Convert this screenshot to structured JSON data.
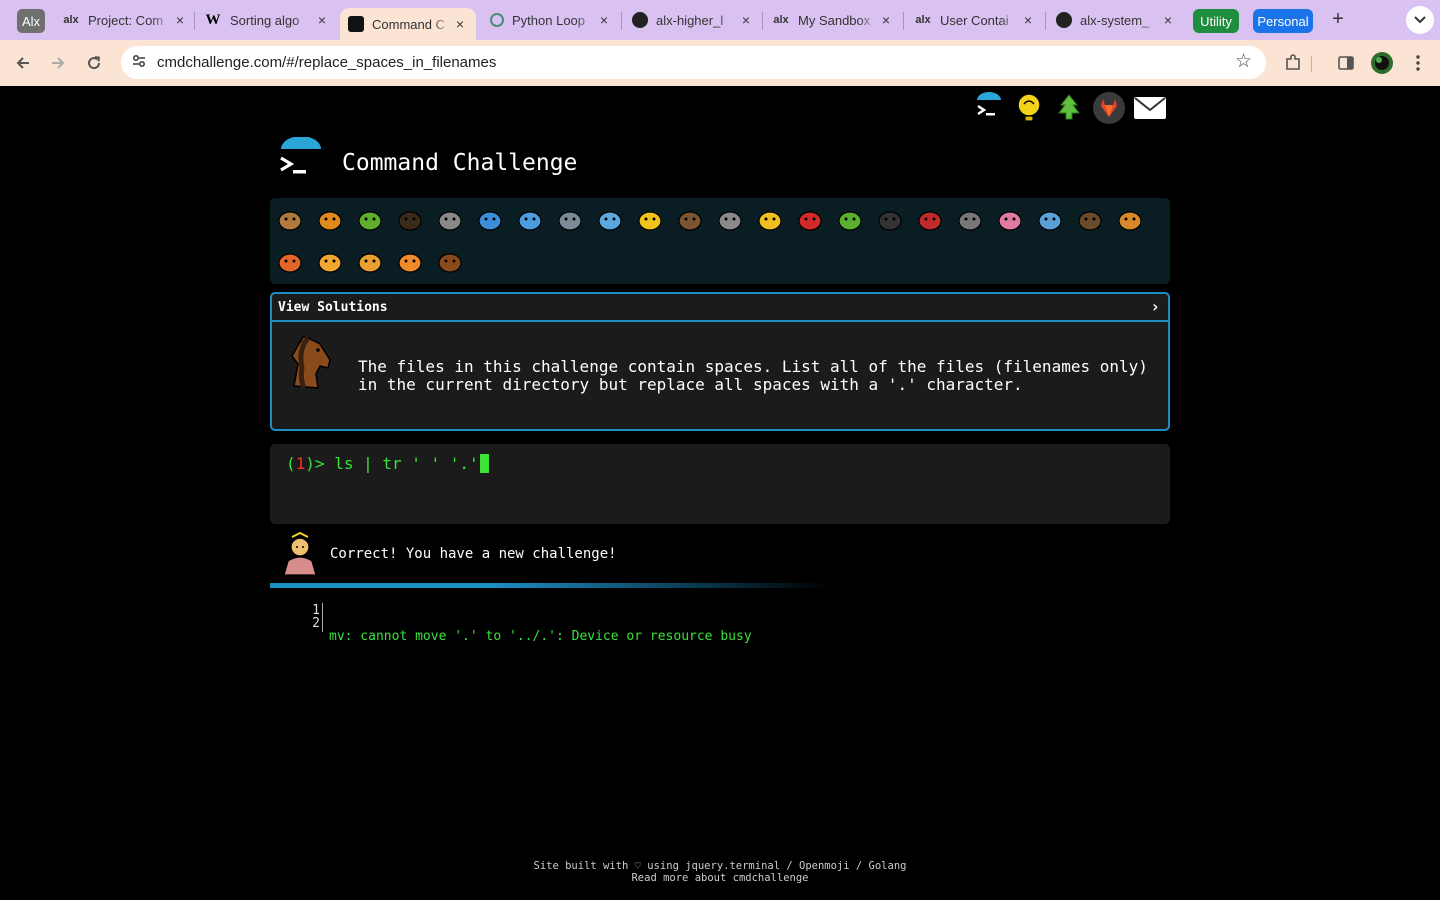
{
  "browser": {
    "profile_chip": "Alx",
    "tabs": [
      {
        "favicon": "alx",
        "title": "Project: Com"
      },
      {
        "favicon": "W",
        "title": "Sorting algo"
      },
      {
        "favicon": "terminal",
        "title": "Command C"
      },
      {
        "favicon": "chatgpt",
        "title": "Python Loop"
      },
      {
        "favicon": "github",
        "title": "alx-higher_l"
      },
      {
        "favicon": "alx",
        "title": "My Sandbox"
      },
      {
        "favicon": "alx",
        "title": "User Contai"
      },
      {
        "favicon": "github",
        "title": "alx-system_"
      }
    ],
    "close_glyph": "×",
    "tab_groups": [
      {
        "label": "Utility",
        "color": "#1e8e3e"
      },
      {
        "label": "Personal",
        "color": "#1a73e8"
      }
    ],
    "new_tab_glyph": "+",
    "url": "cmdchallenge.com/#/replace_spaces_in_filenames",
    "icons": {
      "back": "back-arrow-icon",
      "forward": "forward-arrow-icon",
      "reload": "reload-icon",
      "site_info": "tune-icon",
      "bookmark": "star-icon",
      "extensions": "puzzle-icon",
      "side_panel": "side-panel-icon",
      "avatar": "profile-avatar-icon",
      "menu": "kebab-menu-icon",
      "tab_search": "chevron-down-icon"
    }
  },
  "site": {
    "title": "Command Challenge",
    "social_icons": [
      "terminal-logo-icon",
      "bulb-icon",
      "tree-icon",
      "gitlab-icon",
      "mail-icon"
    ],
    "animals_row1": [
      "snail-icon",
      "butterfly-icon",
      "caterpillar-icon",
      "ant-icon",
      "spider-web-icon",
      "whale-icon",
      "dolphin-icon",
      "shark-icon",
      "fish-icon",
      "tropical-fish-icon",
      "hedgehog-icon",
      "wolf-icon",
      "bee-icon",
      "ladybug-icon",
      "lizard-icon",
      "spider-icon",
      "scorpion-icon",
      "fly-icon",
      "worm-icon",
      "microbe-icon",
      "gorilla-icon",
      "dog-icon"
    ],
    "animals_row2": [
      "fox-icon",
      "cat-icon",
      "lion-icon",
      "tiger-icon",
      "horse-icon"
    ],
    "challenge": {
      "header": "View Solutions",
      "chevron": "›",
      "description": "The files in this challenge contain spaces. List all of the files (filenames only)\nin the current directory but replace all spaces with a '.' character.",
      "avatar": "horse-icon"
    },
    "terminal": {
      "prompt_open": "(",
      "prompt_number": "1",
      "prompt_close": ")> ",
      "command": "ls | tr ' ' '.'"
    },
    "feedback": {
      "message": "Correct! You have a new challenge!",
      "avatar": "fairy-icon"
    },
    "output": {
      "line_numbers": [
        "1",
        "2"
      ],
      "lines": [
        "mv: cannot move '.' to '../.': Device or resource busy",
        ""
      ]
    },
    "footer": {
      "line1": "Site built with ♡ using jquery.terminal / Openmoji / Golang",
      "line2": "Read more about cmdchallenge"
    }
  }
}
